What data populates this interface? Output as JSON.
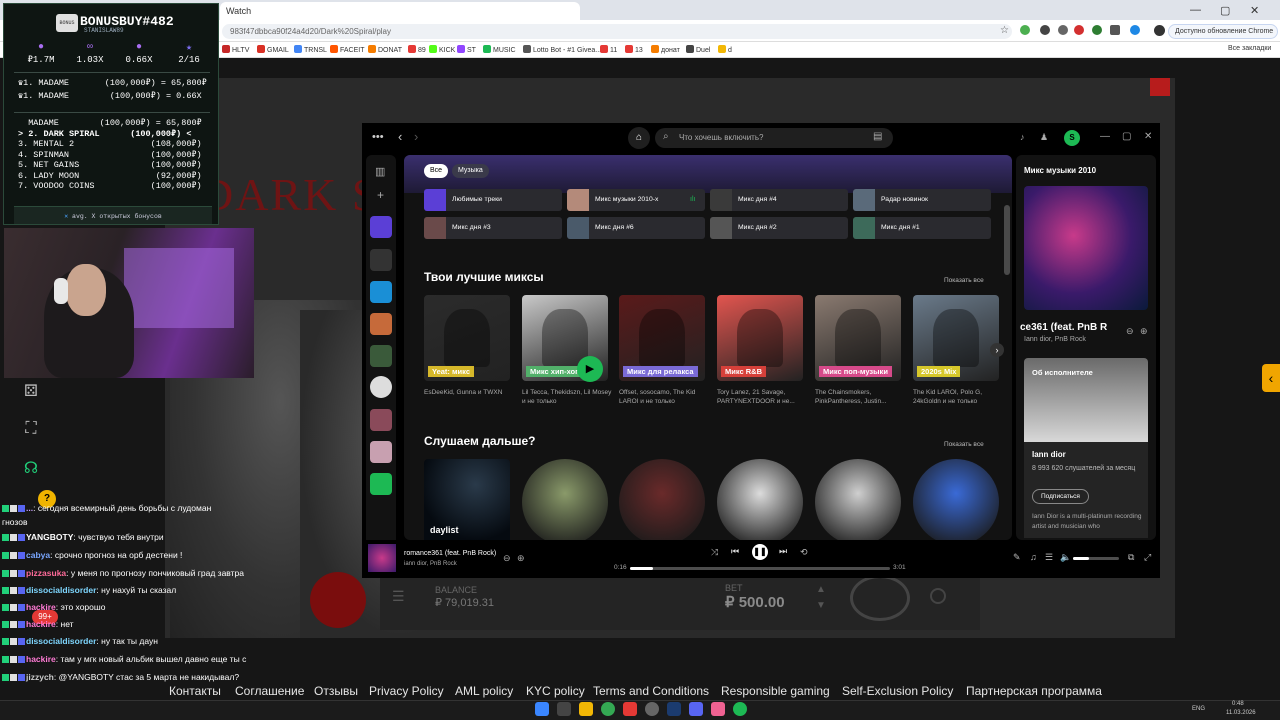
{
  "browser": {
    "tab_title": "Watch",
    "url": "983f47dbbca90f24a4d20/Dark%20Spiral/play",
    "update_button": "Доступно обновление Chrome",
    "all_bookmarks": "Все закладки",
    "bookmarks": [
      {
        "label": "HLTV",
        "color": "#c62828"
      },
      {
        "label": "GMAIL",
        "color": "#d93025"
      },
      {
        "label": "TRNSL",
        "color": "#4285f4"
      },
      {
        "label": "FACEIT",
        "color": "#ff5500"
      },
      {
        "label": "DONAT",
        "color": "#f57c00"
      },
      {
        "label": "89",
        "color": "#e53935"
      },
      {
        "label": "KICK",
        "color": "#53fc18"
      },
      {
        "label": "ST",
        "color": "#9146ff"
      },
      {
        "label": "MUSIC",
        "color": "#1db954"
      },
      {
        "label": "Lotto Bot - #1 Givea...",
        "color": "#555555"
      },
      {
        "label": "11",
        "color": "#e53935"
      },
      {
        "label": "13",
        "color": "#e53935"
      },
      {
        "label": "донат",
        "color": "#f57c00"
      },
      {
        "label": "Duel",
        "color": "#444444"
      },
      {
        "label": "d",
        "color": "#f2b705"
      }
    ]
  },
  "bonus_panel": {
    "logo_text": "BONUS",
    "title": "BONUSBUY#482",
    "subtitle": "STANISLAW89",
    "stats": [
      {
        "icon": "●",
        "value": "₽1.7M",
        "color": "#a86df0"
      },
      {
        "icon": "∞",
        "value": "1.03X",
        "color": "#a86df0"
      },
      {
        "icon": "●",
        "value": "0.66X",
        "color": "#a86df0"
      },
      {
        "icon": "★",
        "value": "2/16",
        "color": "#7c6df0"
      }
    ],
    "best": [
      "♛1. MADAME       (100,000₽) = 65,800₽",
      "♛1. MADAME        (100,000₽) = 0.66X"
    ],
    "list": [
      "  MADAME        (100,000₽) = 65,800₽",
      "> 2. DARK SPIRAL      (100,000₽) <",
      "3. MENTAL 2               (108,000₽)",
      "4. SPINMAN                (100,000₽)",
      "5. NET GAINS              (100,000₽)",
      "6. LADY MOON               (92,000₽)",
      "7. VOODOO COINS           (100,000₽)"
    ],
    "footer": "avg. X открытых бонусов"
  },
  "casino": {
    "game_title": "DARK SPI",
    "balance_label": "BALANCE",
    "balance_value": "₽ 79,019.31",
    "bet_label": "BET",
    "bet_value": "₽ 500.00",
    "footer_links": [
      "Контакты",
      "Соглашение",
      "Отзывы",
      "Privacy Policy",
      "AML policy",
      "KYC policy",
      "Terms and Conditions",
      "Responsible gaming",
      "Self-Exclusion Policy",
      "Партнерская программа"
    ]
  },
  "chat": [
    {
      "user": "...",
      "text": "сегодня всемирный день борьбы с лудоман",
      "ucolor": "#c69cff"
    },
    {
      "user": "",
      "text": "гнозов",
      "ucolor": "#ffffff"
    },
    {
      "user": "YANGBOTY",
      "text": "чувствую тебя внутри",
      "ucolor": "#ffffff"
    },
    {
      "user": "cabya",
      "text": "срочно прогноз на орб дестени !",
      "ucolor": "#7aa7ff"
    },
    {
      "user": "pizzasuka",
      "text": "у меня по прогнозу пончиковый град завтра",
      "ucolor": "#ff6b9a"
    },
    {
      "user": "dissocialdisorder",
      "text": "ну нахуй ты сказал",
      "ucolor": "#7fd7ff"
    },
    {
      "user": "hackire",
      "text": "это хорошо",
      "ucolor": "#ff7bd5"
    },
    {
      "user": "hackire",
      "text": "нет",
      "ucolor": "#ff7bd5"
    },
    {
      "user": "dissocialdisorder",
      "text": "ну так ты даун",
      "ucolor": "#7fd7ff"
    },
    {
      "user": "hackire",
      "text": "там у мгк новый альбик вышел давно еще ты с",
      "ucolor": "#ff7bd5"
    },
    {
      "user": "jizzych",
      "text": "@YANGBOTY стас за 5 марта не накидывал?",
      "ucolor": "#cccccc"
    }
  ],
  "spotify": {
    "search_placeholder": "Что хочешь включить?",
    "filters": [
      "Все",
      "Музыка"
    ],
    "quick_tiles": [
      {
        "label": "Любимые треки",
        "color": "#5b3fd6"
      },
      {
        "label": "Микс музыки 2010-х",
        "color": "#b48a7a"
      },
      {
        "label": "Микс дня #4",
        "color": "#3a3a3a"
      },
      {
        "label": "Радар новинок",
        "color": "#5a6a7a"
      },
      {
        "label": "Микс дня #3",
        "color": "#6a4a4a"
      },
      {
        "label": "Микс дня #6",
        "color": "#4a5a6a"
      },
      {
        "label": "Микс дня #2",
        "color": "#555555"
      },
      {
        "label": "Микс дня #1",
        "color": "#3d6a5a"
      }
    ],
    "section1": {
      "title": "Твои лучшие миксы",
      "show_all": "Показать все",
      "cards": [
        {
          "tag": "Yeat: микс",
          "tag_color": "#d6b82a",
          "bg": "#2b2b2b",
          "caption": "EsDeeKid, Gunna и TWXN"
        },
        {
          "tag": "Микс хип-хоп",
          "tag_color": "#52b06a",
          "bg": "#c9c9c9",
          "caption": "Lil Tecca, Thekidszn, Lil Mosey и не только"
        },
        {
          "tag": "Микс для релакса",
          "tag_color": "#7a6ad6",
          "bg": "#5a1a1a",
          "caption": "Offset, sosocamo, The Kid LAROI и не только"
        },
        {
          "tag": "Микс R&B",
          "tag_color": "#d6403a",
          "bg": "#e2554f",
          "caption": "Tory Lanez, 21 Savage, PARTYNEXTDOOR и не..."
        },
        {
          "tag": "Микс поп-музыки",
          "tag_color": "#d64a8a",
          "bg": "#8a7a70",
          "caption": "The Chainsmokers, PinkPantheress, Justin..."
        },
        {
          "tag": "2020s Mix",
          "tag_color": "#d6c72a",
          "bg": "#6a7a8a",
          "caption": "The Kid LAROI, Polo G, 24kGoldn и не только"
        }
      ]
    },
    "section2": {
      "title": "Слушаем дальше?",
      "show_all": "Показать все",
      "first_label": "daylist",
      "circles": [
        "#8a9a6a",
        "#6a2a2a",
        "#dcdcdc",
        "#cfcfcf",
        "#3a6ad6"
      ]
    },
    "right_panel": {
      "header": "Микс музыки 2010",
      "track": "ce361 (feat. PnB R",
      "artists": "Iann dior, PnB Rock",
      "about_label": "Об исполнителе",
      "artist_name": "Iann dior",
      "listeners": "8 993 620 слушателей за месяц",
      "follow": "Подписаться",
      "bio": "Iann Dior is a multi-platinum recording artist and musician who"
    },
    "player": {
      "track": "romance361 (feat. PnB Rock)",
      "artists": "iann dior, PnB Rock",
      "elapsed": "0:16",
      "duration": "3:01",
      "progress": 0.09,
      "volume": 0.35
    }
  },
  "taskbar": {
    "lang": "ENG",
    "time": "0:48",
    "date": "11.03.2026"
  },
  "misc": {
    "chat_help": "?",
    "chat_badge": "99+"
  }
}
